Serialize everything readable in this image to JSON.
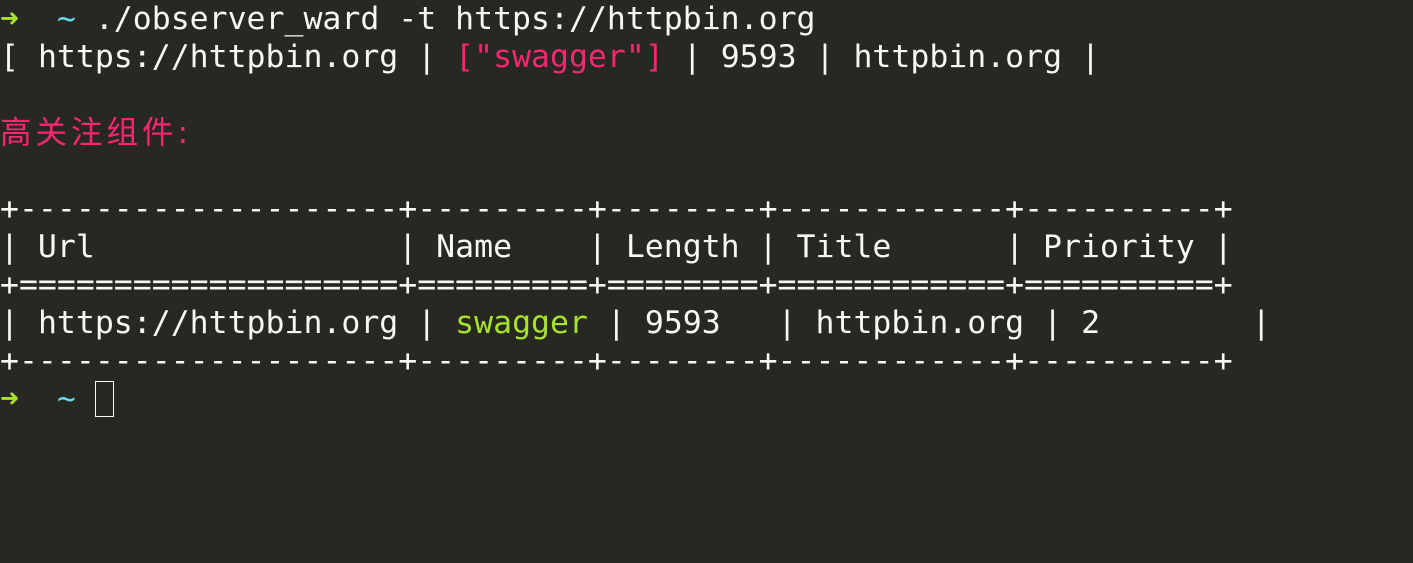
{
  "prompt": {
    "arrow": "➜",
    "tilde": "~"
  },
  "command": " ./observer_ward -t https://httpbin.org",
  "result_line": {
    "open": "[ ",
    "url": "https://httpbin.org",
    "sep1": " | ",
    "names": "[\"swagger\"]",
    "sep2": " | ",
    "length": "9593",
    "sep3": " | ",
    "title": "httpbin.org",
    "close": " |"
  },
  "section_heading": "高关注组件:",
  "table": {
    "border_top": "+--------------------+---------+--------+------------+----------+",
    "header_row": "| Url                | Name    | Length | Title      | Priority |",
    "header_separator": "+====================+=========+========+============+==========+",
    "row": {
      "prefix": "| ",
      "url": "https://httpbin.org",
      "mid1": " | ",
      "name": "swagger",
      "mid2": " | ",
      "length": "9593",
      "mid3": "   | ",
      "title": "httpbin.org",
      "mid4": " | ",
      "priority": "2",
      "suffix": "        |"
    },
    "border_bottom": "+--------------------+---------+--------+------------+----------+"
  },
  "colors": {
    "background": "#272822",
    "foreground": "#f8f8f2",
    "arrow": "#a6e22e",
    "tilde": "#66d9ef",
    "highlight_pink": "#f92672",
    "highlight_green": "#a6e22e"
  }
}
